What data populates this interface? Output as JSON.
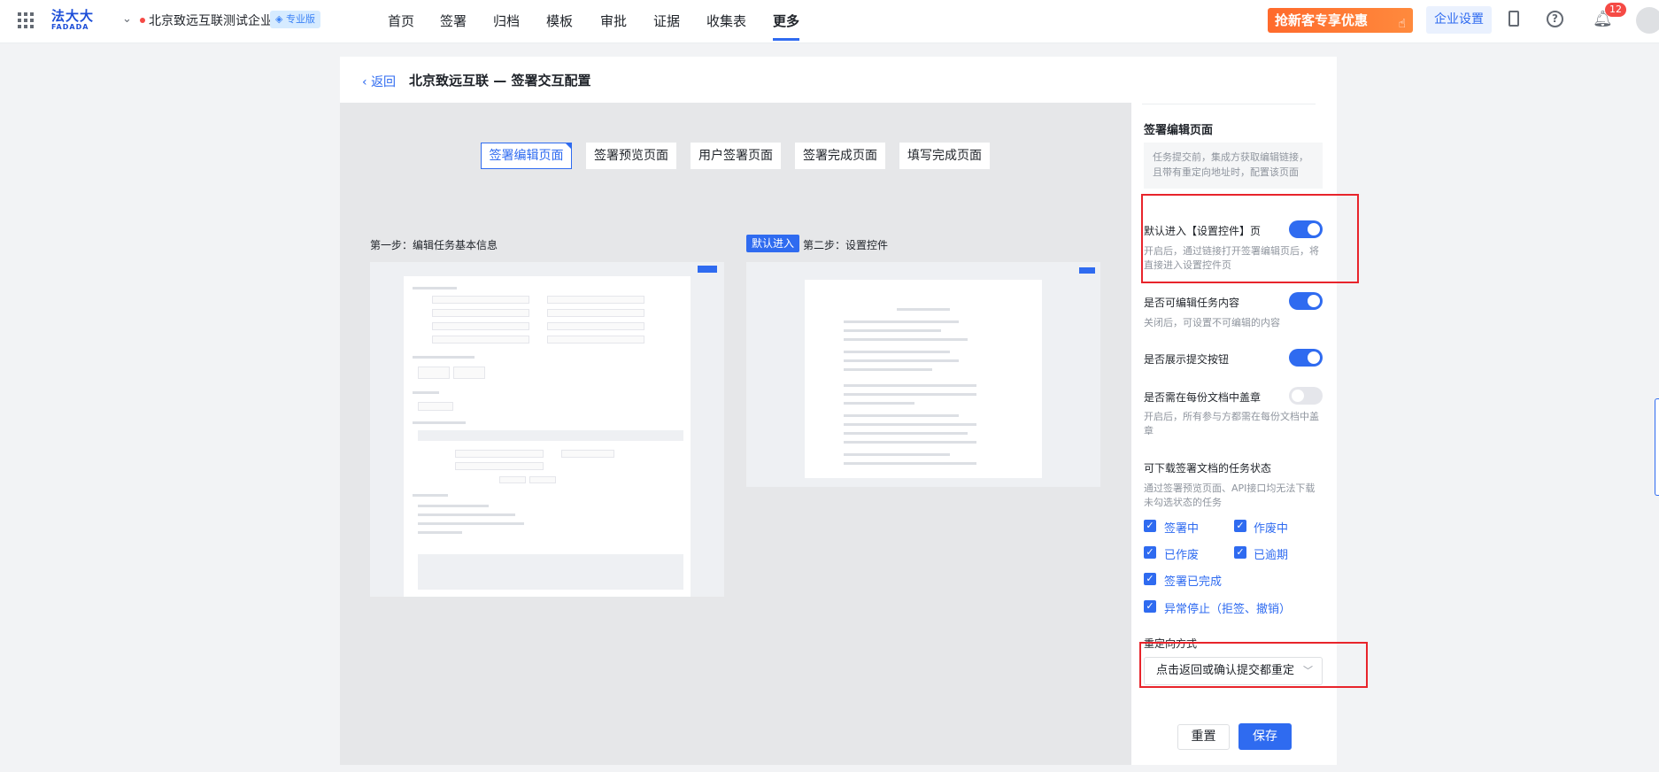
{
  "topbar": {
    "logo_cn": "法大大",
    "logo_en": "FADADA",
    "org_name": "北京致远互联测试企业",
    "edition": "专业版",
    "nav": [
      "首页",
      "签署",
      "归档",
      "模板",
      "审批",
      "证据",
      "收集表",
      "更多"
    ],
    "active_nav": "更多",
    "promo": "抢新客专享优惠",
    "enterprise_settings": "企业设置",
    "help": "?",
    "notification_count": "12"
  },
  "page": {
    "back": "返回",
    "title": "北京致远互联 — 签署交互配置"
  },
  "tabs": [
    "签署编辑页面",
    "签署预览页面",
    "用户签署页面",
    "签署完成页面",
    "填写完成页面"
  ],
  "active_tab": "签署编辑页面",
  "preview": {
    "step1": "第一步：编辑任务基本信息",
    "default_tag": "默认进入",
    "step2": "第二步：设置控件"
  },
  "panel": {
    "title": "签署编辑页面",
    "desc": "任务提交前，集成方获取编辑链接，且带有重定向地址时，配置该页面",
    "options": [
      {
        "label": "默认进入【设置控件】页",
        "desc": "开启后，通过链接打开签署编辑页后，将直接进入设置控件页",
        "on": true
      },
      {
        "label": "是否可编辑任务内容",
        "desc": "关闭后，可设置不可编辑的内容",
        "on": true
      },
      {
        "label": "是否展示提交按钮",
        "desc": "",
        "on": true
      },
      {
        "label": "是否需在每份文档中盖章",
        "desc": "开启后，所有参与方都需在每份文档中盖章",
        "on": false
      }
    ],
    "download_title": "可下载签署文档的任务状态",
    "download_desc": "通过签署预览页面、API接口均无法下载未勾选状态的任务",
    "statuses": [
      "签署中",
      "作废中",
      "已作废",
      "已逾期",
      "签署已完成",
      "异常停止（拒签、撤销）"
    ],
    "redirect_label": "重定向方式",
    "redirect_value": "点击返回或确认提交都重定",
    "reset": "重置",
    "save": "保存"
  }
}
